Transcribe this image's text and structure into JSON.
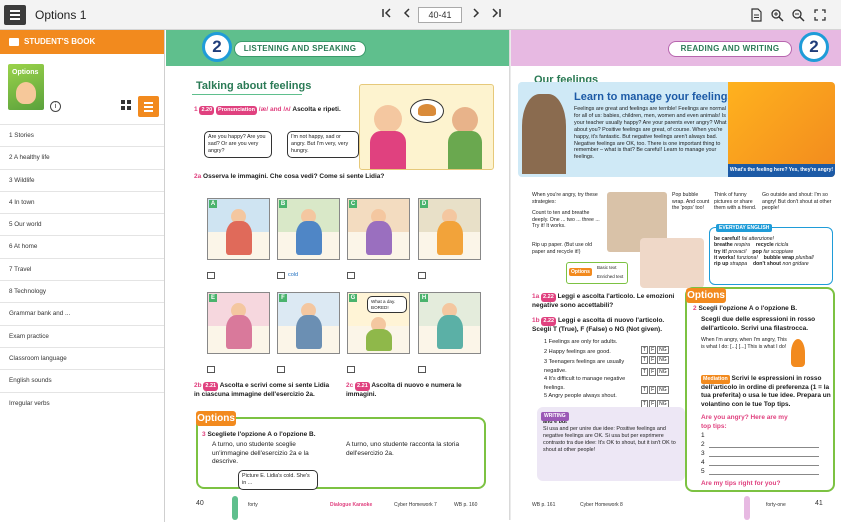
{
  "app": {
    "title": "Options 1",
    "page_range": "40-41"
  },
  "sidebar": {
    "header": "STUDENT'S BOOK",
    "cover_title": "Options",
    "items": [
      {
        "label": "1 Stories"
      },
      {
        "label": "2 A healthy life"
      },
      {
        "label": "3 Wildlife"
      },
      {
        "label": "4 In town"
      },
      {
        "label": "5 Our world"
      },
      {
        "label": "6 At home"
      },
      {
        "label": "7 Travel"
      },
      {
        "label": "8 Technology"
      },
      {
        "label": "Grammar bank and ..."
      },
      {
        "label": "Exam practice"
      },
      {
        "label": "Classroom language"
      },
      {
        "label": "English sounds"
      },
      {
        "label": "Irregular verbs"
      }
    ]
  },
  "left_page": {
    "unit": "2",
    "section": "LISTENING AND SPEAKING",
    "title": "Talking about feelings",
    "ex1_num": "1",
    "ex1_track": "2.20",
    "ex1_chip": "Pronunciation",
    "ex1_sounds": "/æ/ and /ʌ/",
    "ex1_text": "Ascolta e ripeti.",
    "bubble1": "Are you happy? Are you sad? Or are you very angry?",
    "bubble2": "I'm not happy, sad or angry. But I'm very, very hungry.",
    "ex2a_num": "2a",
    "ex2a_text": "Osserva le immagini. Che cosa vedi? Come si sente Lidia?",
    "frame_labels": [
      "A",
      "B",
      "C",
      "D",
      "E",
      "F",
      "G",
      "H"
    ],
    "cold_word": "cold",
    "bubble_g": "What a day. BORED!",
    "ex2b_num": "2b",
    "ex2b_track": "2.21",
    "ex2b_text": "Ascolta e scrivi come si sente Lidia in ciascuna immagine dell'esercizio 2a.",
    "ex2c_num": "2c",
    "ex2c_track": "2.21",
    "ex2c_text": "Ascolta di nuovo e numera le immagini.",
    "options_label": "Options",
    "ex3_num": "3",
    "ex3_text": "Scegliete l'opzione A o l'opzione B.",
    "ex3_a": "A turno, uno studente sceglie un'immagine dell'esercizio 2a e la descrive.",
    "ex3_b": "A turno, uno studente racconta la storia dell'esercizio 2a.",
    "ex3_example": "Picture E. Lidia's cold. She's in ...",
    "page_number": "40",
    "footer_word": "forty",
    "footer_links": [
      "Dialogue Karaoke",
      "Cyber Homework 7",
      "WB p. 160"
    ]
  },
  "right_page": {
    "unit": "2",
    "section": "READING AND WRITING",
    "title": "Our feelings",
    "hero_title": "Learn to manage your feelings",
    "hero_text": "Feelings are great and feelings are terrible! Feelings are normal for all of us: babies, children, men, women and even animals! Is your teacher usually happy? Are your parents ever angry? What about you? Positive feelings are great, of course. When you're happy, it's fantastic. But negative feelings aren't always bad. Negative feelings are OK, too. There is one important thing to remember – what is that? Be careful! Learn to manage your feelings.",
    "hero_question": "What's the feeling here? Yes, they're angry!",
    "intro": "When you're angry, try these strategies:",
    "step1": "Count to ten and breathe deeply. One ... two ... three ... Try it! It works.",
    "step2": "Rip up paper. (But use old paper and recycle it!)",
    "step3": "Pop bubble wrap. And count the 'pops' too!",
    "step4": "Think of funny pictures or share them with a friend.",
    "step5": "Go outside and shout: I'm so angry! But don't shout at other people!",
    "options_mini": "Options",
    "mini_links": [
      "Basic text",
      "Enriched text"
    ],
    "everyday_tag": "EVERYDAY ENGLISH",
    "everyday": [
      {
        "en": "be careful!",
        "it": "fai attenzione!"
      },
      {
        "en": "breathe",
        "it": "respira"
      },
      {
        "en": "recycle",
        "it": "ricicla"
      },
      {
        "en": "try it!",
        "it": "provaci!"
      },
      {
        "en": "pop",
        "it": "far scoppiare"
      },
      {
        "en": "it works!",
        "it": "funziona!"
      },
      {
        "en": "bubble wrap",
        "it": "pluriball"
      },
      {
        "en": "rip up",
        "it": "strappa"
      },
      {
        "en": "don't shout",
        "it": "non gridare"
      }
    ],
    "ex1a_num": "1a",
    "ex1a_track": "2.22",
    "ex1a_text": "Leggi e ascolta l'articolo. Le emozioni negative sono accettabili?",
    "ex1b_num": "1b",
    "ex1b_track": "2.22",
    "ex1b_text": "Leggi e ascolta di nuovo l'articolo. Scegli T (True), F (False) o NG (Not given).",
    "statements": [
      "1 Feelings are only for adults.",
      "2 Happy feelings are good.",
      "3 Teenagers feelings are usually negative.",
      "4 It's difficult to manage negative feelings.",
      "5 Angry people always shout."
    ],
    "tfng": [
      "T",
      "F",
      "NG"
    ],
    "writing_tag": "WRITING",
    "writing_title": "and e but",
    "writing_text": "Si usa and per unire due idee: Positive feelings and negative feelings are OK. Si usa but per esprimere contrasto tra due idee: It's OK to shout, but it isn't OK to shout at other people!",
    "options_label": "Options",
    "ex2_num": "2",
    "ex2_text": "Scegli l'opzione A o l'opzione B.",
    "ex2_a": "Scegli due delle espressioni in rosso dell'articolo. Scrivi una filastrocca.",
    "ex2_a_example": "When I'm angry, when I'm angry, This is what I do: [...] [...] This is what I do!",
    "ex2_b_chip": "Mediation",
    "ex2_b": "Scrivi le espressioni in rosso dell'articolo in ordine di preferenza (1 = la tua preferita) o usa le tue idee. Prepara un volantino con le tue Top tips.",
    "tips_title": "Are you angry? Here are my top tips:",
    "tips_lines": [
      "1",
      "2",
      "3",
      "4",
      "5"
    ],
    "tips_footer": "Are my tips right for you?",
    "page_number": "41",
    "footer_word": "forty-one",
    "footer_links": [
      "WB p. 161",
      "Cyber Homework 8"
    ]
  },
  "colors": {
    "accent_orange": "#f28a1e",
    "listening_green": "#5fbf8d",
    "reading_pink": "#e7b9e2",
    "unit_blue": "#1f9cd8",
    "options_green": "#7cc242"
  },
  "icons": [
    "menu-icon",
    "first-page-icon",
    "prev-page-icon",
    "next-page-icon",
    "last-page-icon",
    "document-icon",
    "zoom-in-icon",
    "zoom-out-icon",
    "fullscreen-icon",
    "book-icon",
    "info-icon",
    "grid-view-icon",
    "list-view-icon"
  ]
}
